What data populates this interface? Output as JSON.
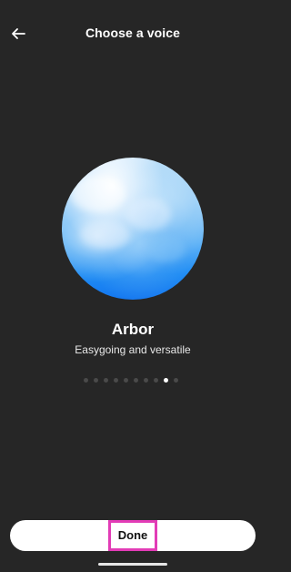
{
  "header": {
    "title": "Choose a voice",
    "back_icon": "arrow-left-icon"
  },
  "voice": {
    "name": "Arbor",
    "description": "Easygoing and versatile",
    "orb_colors": [
      "#ffffff",
      "#a9d6f9",
      "#5fb2f6",
      "#1477f0"
    ]
  },
  "pager": {
    "total": 10,
    "active_index": 8
  },
  "footer": {
    "done_label": "Done",
    "highlight_color": "#e23cb6"
  },
  "colors": {
    "background": "#262626",
    "text": "#ffffff",
    "button_bg": "#ffffff"
  }
}
